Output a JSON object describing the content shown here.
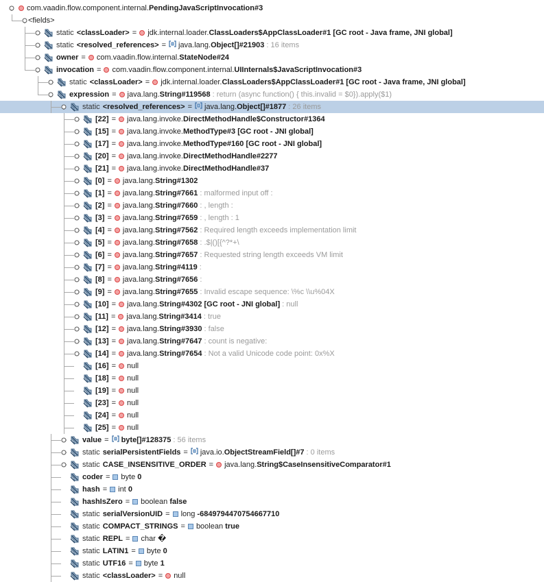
{
  "title": "Debugger variables tree",
  "rows": [
    {
      "d": 0,
      "h": "open",
      "line": "last",
      "parts": [
        {
          "t": "com.vaadin.flow.component.internal."
        },
        {
          "b": "PendingJavaScriptInvocation#3"
        }
      ],
      "ic": "obj"
    },
    {
      "d": 1,
      "h": "open",
      "line": "last",
      "fields": true,
      "parts": [
        {
          "t": "<fields>"
        }
      ]
    },
    {
      "d": 2,
      "h": "closed",
      "line": "mid",
      "ic": "field",
      "mod": "static",
      "name": "<classLoader>",
      "ot": "obj",
      "parts": [
        {
          "t": "jdk.internal.loader."
        },
        {
          "b": "ClassLoaders$AppClassLoader#1 [GC root - Java frame, JNI global]"
        }
      ]
    },
    {
      "d": 2,
      "h": "closed",
      "line": "mid",
      "ic": "field",
      "mod": "static",
      "name": "<resolved_references>",
      "ot": "arr",
      "parts": [
        {
          "t": "java.lang."
        },
        {
          "b": "Object[]#21903"
        },
        {
          "g": " : 16 items"
        }
      ]
    },
    {
      "d": 2,
      "h": "closed",
      "line": "mid",
      "ic": "field",
      "name": "owner",
      "ot": "obj",
      "parts": [
        {
          "t": "com.vaadin.flow.internal."
        },
        {
          "b": "StateNode#24"
        }
      ]
    },
    {
      "d": 2,
      "h": "open",
      "line": "last",
      "ic": "field",
      "name": "invocation",
      "ot": "obj",
      "parts": [
        {
          "t": "com.vaadin.flow.component.internal."
        },
        {
          "b": "UIInternals$JavaScriptInvocation#3"
        }
      ]
    },
    {
      "d": 3,
      "h": "closed",
      "line": "mid",
      "ic": "field",
      "mod": "static",
      "name": "<classLoader>",
      "ot": "obj",
      "parts": [
        {
          "t": "jdk.internal.loader."
        },
        {
          "b": "ClassLoaders$AppClassLoader#1 [GC root - Java frame, JNI global]"
        }
      ]
    },
    {
      "d": 3,
      "h": "open",
      "line": "last",
      "ic": "field",
      "name": "expression",
      "ot": "obj",
      "parts": [
        {
          "t": "java.lang."
        },
        {
          "b": "String#119568"
        },
        {
          "g": " : return (async function() { this.invalid = $0}).apply($1)"
        }
      ]
    },
    {
      "d": 4,
      "h": "open",
      "line": "mid",
      "sel": true,
      "ic": "field",
      "mod": "static",
      "name": "<resolved_references>",
      "ot": "arr",
      "parts": [
        {
          "t": "java.lang."
        },
        {
          "b": "Object[]#1877"
        },
        {
          "g": " : 26 items"
        }
      ]
    },
    {
      "d": 5,
      "h": "closed",
      "line": "mid",
      "ic": "field",
      "name": "[22]",
      "ot": "obj",
      "parts": [
        {
          "t": "java.lang.invoke."
        },
        {
          "b": "DirectMethodHandle$Constructor#1364"
        }
      ]
    },
    {
      "d": 5,
      "h": "closed",
      "line": "mid",
      "ic": "field",
      "name": "[15]",
      "ot": "obj",
      "parts": [
        {
          "t": "java.lang.invoke."
        },
        {
          "b": "MethodType#3 [GC root - JNI global]"
        }
      ]
    },
    {
      "d": 5,
      "h": "closed",
      "line": "mid",
      "ic": "field",
      "name": "[17]",
      "ot": "obj",
      "parts": [
        {
          "t": "java.lang.invoke."
        },
        {
          "b": "MethodType#160 [GC root - JNI global]"
        }
      ]
    },
    {
      "d": 5,
      "h": "closed",
      "line": "mid",
      "ic": "field",
      "name": "[20]",
      "ot": "obj",
      "parts": [
        {
          "t": "java.lang.invoke."
        },
        {
          "b": "DirectMethodHandle#2277"
        }
      ]
    },
    {
      "d": 5,
      "h": "closed",
      "line": "mid",
      "ic": "field",
      "name": "[21]",
      "ot": "obj",
      "parts": [
        {
          "t": "java.lang.invoke."
        },
        {
          "b": "DirectMethodHandle#37"
        }
      ]
    },
    {
      "d": 5,
      "h": "closed",
      "line": "mid",
      "ic": "field",
      "name": "[0]",
      "ot": "obj",
      "parts": [
        {
          "t": "java.lang."
        },
        {
          "b": "String#1302"
        }
      ]
    },
    {
      "d": 5,
      "h": "closed",
      "line": "mid",
      "ic": "field",
      "name": "[1]",
      "ot": "obj",
      "parts": [
        {
          "t": "java.lang."
        },
        {
          "b": "String#7661"
        },
        {
          "g": " : malformed input off : "
        }
      ]
    },
    {
      "d": 5,
      "h": "closed",
      "line": "mid",
      "ic": "field",
      "name": "[2]",
      "ot": "obj",
      "parts": [
        {
          "t": "java.lang."
        },
        {
          "b": "String#7660"
        },
        {
          "g": " : , length : "
        }
      ]
    },
    {
      "d": 5,
      "h": "closed",
      "line": "mid",
      "ic": "field",
      "name": "[3]",
      "ot": "obj",
      "parts": [
        {
          "t": "java.lang."
        },
        {
          "b": "String#7659"
        },
        {
          "g": " : , length : 1"
        }
      ]
    },
    {
      "d": 5,
      "h": "closed",
      "line": "mid",
      "ic": "field",
      "name": "[4]",
      "ot": "obj",
      "parts": [
        {
          "t": "java.lang."
        },
        {
          "b": "String#7562"
        },
        {
          "g": " : Required length exceeds implementation limit"
        }
      ]
    },
    {
      "d": 5,
      "h": "closed",
      "line": "mid",
      "ic": "field",
      "name": "[5]",
      "ot": "obj",
      "parts": [
        {
          "t": "java.lang."
        },
        {
          "b": "String#7658"
        },
        {
          "g": " : .$|()[{^?*+\\"
        }
      ]
    },
    {
      "d": 5,
      "h": "closed",
      "line": "mid",
      "ic": "field",
      "name": "[6]",
      "ot": "obj",
      "parts": [
        {
          "t": "java.lang."
        },
        {
          "b": "String#7657"
        },
        {
          "g": " : Requested string length exceeds VM limit"
        }
      ]
    },
    {
      "d": 5,
      "h": "closed",
      "line": "mid",
      "ic": "field",
      "name": "[7]",
      "ot": "obj",
      "parts": [
        {
          "t": "java.lang."
        },
        {
          "b": "String#4119"
        },
        {
          "g": " : "
        }
      ]
    },
    {
      "d": 5,
      "h": "closed",
      "line": "mid",
      "ic": "field",
      "name": "[8]",
      "ot": "obj",
      "parts": [
        {
          "t": "java.lang."
        },
        {
          "b": "String#7656"
        },
        {
          "g": " : "
        }
      ]
    },
    {
      "d": 5,
      "h": "closed",
      "line": "mid",
      "ic": "field",
      "name": "[9]",
      "ot": "obj",
      "parts": [
        {
          "t": "java.lang."
        },
        {
          "b": "String#7655"
        },
        {
          "g": " : Invalid escape sequence: \\%c \\\\u%04X"
        }
      ]
    },
    {
      "d": 5,
      "h": "closed",
      "line": "mid",
      "ic": "field",
      "name": "[10]",
      "ot": "obj",
      "parts": [
        {
          "t": "java.lang."
        },
        {
          "b": "String#4302 [GC root - JNI global]"
        },
        {
          "g": " : null"
        }
      ]
    },
    {
      "d": 5,
      "h": "closed",
      "line": "mid",
      "ic": "field",
      "name": "[11]",
      "ot": "obj",
      "parts": [
        {
          "t": "java.lang."
        },
        {
          "b": "String#3414"
        },
        {
          "g": " : true"
        }
      ]
    },
    {
      "d": 5,
      "h": "closed",
      "line": "mid",
      "ic": "field",
      "name": "[12]",
      "ot": "obj",
      "parts": [
        {
          "t": "java.lang."
        },
        {
          "b": "String#3930"
        },
        {
          "g": " : false"
        }
      ]
    },
    {
      "d": 5,
      "h": "closed",
      "line": "mid",
      "ic": "field",
      "name": "[13]",
      "ot": "obj",
      "parts": [
        {
          "t": "java.lang."
        },
        {
          "b": "String#7647"
        },
        {
          "g": " : count is negative: "
        }
      ]
    },
    {
      "d": 5,
      "h": "closed",
      "line": "mid",
      "ic": "field",
      "name": "[14]",
      "ot": "obj",
      "parts": [
        {
          "t": "java.lang."
        },
        {
          "b": "String#7654"
        },
        {
          "g": " : Not a valid Unicode code point: 0x%X"
        }
      ]
    },
    {
      "d": 5,
      "h": "none",
      "line": "mid",
      "ic": "field",
      "name": "[16]",
      "ot": "obj",
      "parts": [
        {
          "t": "null"
        }
      ]
    },
    {
      "d": 5,
      "h": "none",
      "line": "mid",
      "ic": "field",
      "name": "[18]",
      "ot": "obj",
      "parts": [
        {
          "t": "null"
        }
      ]
    },
    {
      "d": 5,
      "h": "none",
      "line": "mid",
      "ic": "field",
      "name": "[19]",
      "ot": "obj",
      "parts": [
        {
          "t": "null"
        }
      ]
    },
    {
      "d": 5,
      "h": "none",
      "line": "mid",
      "ic": "field",
      "name": "[23]",
      "ot": "obj",
      "parts": [
        {
          "t": "null"
        }
      ]
    },
    {
      "d": 5,
      "h": "none",
      "line": "mid",
      "ic": "field",
      "name": "[24]",
      "ot": "obj",
      "parts": [
        {
          "t": "null"
        }
      ]
    },
    {
      "d": 5,
      "h": "none",
      "line": "last",
      "ic": "field",
      "name": "[25]",
      "ot": "obj",
      "parts": [
        {
          "t": "null"
        }
      ]
    },
    {
      "d": 4,
      "h": "closed",
      "line": "mid",
      "ic": "field",
      "name": "value",
      "ot": "arr",
      "parts": [
        {
          "b": "byte[]#128375"
        },
        {
          "g": " : 56 items"
        }
      ]
    },
    {
      "d": 4,
      "h": "closed",
      "line": "mid",
      "ic": "field",
      "mod": "static",
      "name": "serialPersistentFields",
      "ot": "arr",
      "parts": [
        {
          "t": "java.io."
        },
        {
          "b": "ObjectStreamField[]#7"
        },
        {
          "g": " : 0 items"
        }
      ]
    },
    {
      "d": 4,
      "h": "closed",
      "line": "mid",
      "ic": "field",
      "mod": "static",
      "name": "CASE_INSENSITIVE_ORDER",
      "ot": "obj",
      "parts": [
        {
          "t": "java.lang."
        },
        {
          "b": "String$CaseInsensitiveComparator#1"
        }
      ]
    },
    {
      "d": 4,
      "h": "none",
      "line": "mid",
      "ic": "field",
      "name": "coder",
      "ot": "prim",
      "parts": [
        {
          "t": "byte "
        },
        {
          "b": "0"
        }
      ]
    },
    {
      "d": 4,
      "h": "none",
      "line": "mid",
      "ic": "field",
      "name": "hash",
      "ot": "prim",
      "parts": [
        {
          "t": "int "
        },
        {
          "b": "0"
        }
      ]
    },
    {
      "d": 4,
      "h": "none",
      "line": "mid",
      "ic": "field",
      "name": "hashIsZero",
      "ot": "prim",
      "parts": [
        {
          "t": "boolean "
        },
        {
          "b": "false"
        }
      ]
    },
    {
      "d": 4,
      "h": "none",
      "line": "mid",
      "ic": "field",
      "mod": "static",
      "name": "serialVersionUID",
      "ot": "prim",
      "parts": [
        {
          "t": "long "
        },
        {
          "b": "-6849794470754667710"
        }
      ]
    },
    {
      "d": 4,
      "h": "none",
      "line": "mid",
      "ic": "field",
      "mod": "static",
      "name": "COMPACT_STRINGS",
      "ot": "prim",
      "parts": [
        {
          "t": "boolean "
        },
        {
          "b": "true"
        }
      ]
    },
    {
      "d": 4,
      "h": "none",
      "line": "mid",
      "ic": "field",
      "mod": "static",
      "name": "REPL",
      "ot": "prim",
      "parts": [
        {
          "t": "char "
        },
        {
          "b": "�"
        }
      ]
    },
    {
      "d": 4,
      "h": "none",
      "line": "mid",
      "ic": "field",
      "mod": "static",
      "name": "LATIN1",
      "ot": "prim",
      "parts": [
        {
          "t": "byte "
        },
        {
          "b": "0"
        }
      ]
    },
    {
      "d": 4,
      "h": "none",
      "line": "mid",
      "ic": "field",
      "mod": "static",
      "name": "UTF16",
      "ot": "prim",
      "parts": [
        {
          "t": "byte "
        },
        {
          "b": "1"
        }
      ]
    },
    {
      "d": 4,
      "h": "none",
      "line": "mid",
      "ic": "field",
      "mod": "static",
      "name": "<classLoader>",
      "ot": "obj",
      "parts": [
        {
          "t": "null"
        }
      ]
    }
  ],
  "colors": {
    "selected": "#bcd0e6",
    "line": "#a9a9a9",
    "grey": "#9a9a9a"
  },
  "icons": {
    "field": "field-icon",
    "obj": "object-icon",
    "arr": "array-icon",
    "prim": "primitive-icon",
    "handle": "tree-toggle-icon"
  }
}
